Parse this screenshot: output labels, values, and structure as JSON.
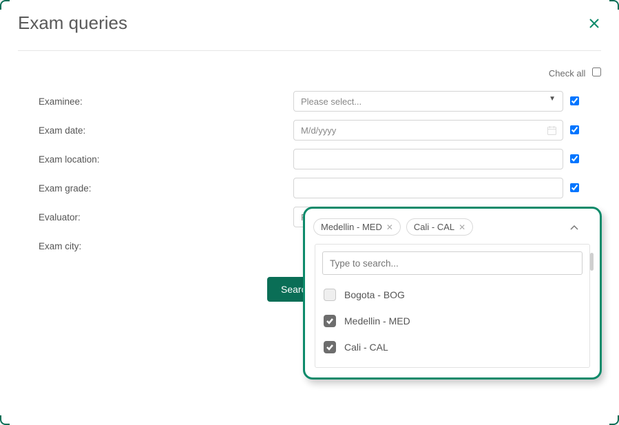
{
  "header": {
    "title": "Exam queries"
  },
  "checkall": {
    "label": "Check all",
    "checked": false
  },
  "fields": {
    "examinee": {
      "label": "Examinee:",
      "placeholder": "Please select...",
      "checked": true
    },
    "exam_date": {
      "label": "Exam date:",
      "placeholder": "M/d/yyyy",
      "checked": true
    },
    "exam_location": {
      "label": "Exam location:",
      "value": "",
      "checked": true
    },
    "exam_grade": {
      "label": "Exam grade:",
      "value": "",
      "checked": true
    },
    "evaluator": {
      "label": "Evaluator:",
      "placeholder": "Please select...",
      "checked": true
    },
    "exam_city": {
      "label": "Exam city:",
      "checked": true,
      "selected": [
        {
          "label": "Medellin - MED"
        },
        {
          "label": "Cali - CAL"
        }
      ],
      "search_placeholder": "Type to search...",
      "options": [
        {
          "label": "Bogota - BOG",
          "checked": false
        },
        {
          "label": "Medellin - MED",
          "checked": true
        },
        {
          "label": "Cali - CAL",
          "checked": true
        }
      ]
    }
  },
  "buttons": {
    "search": "Search"
  }
}
